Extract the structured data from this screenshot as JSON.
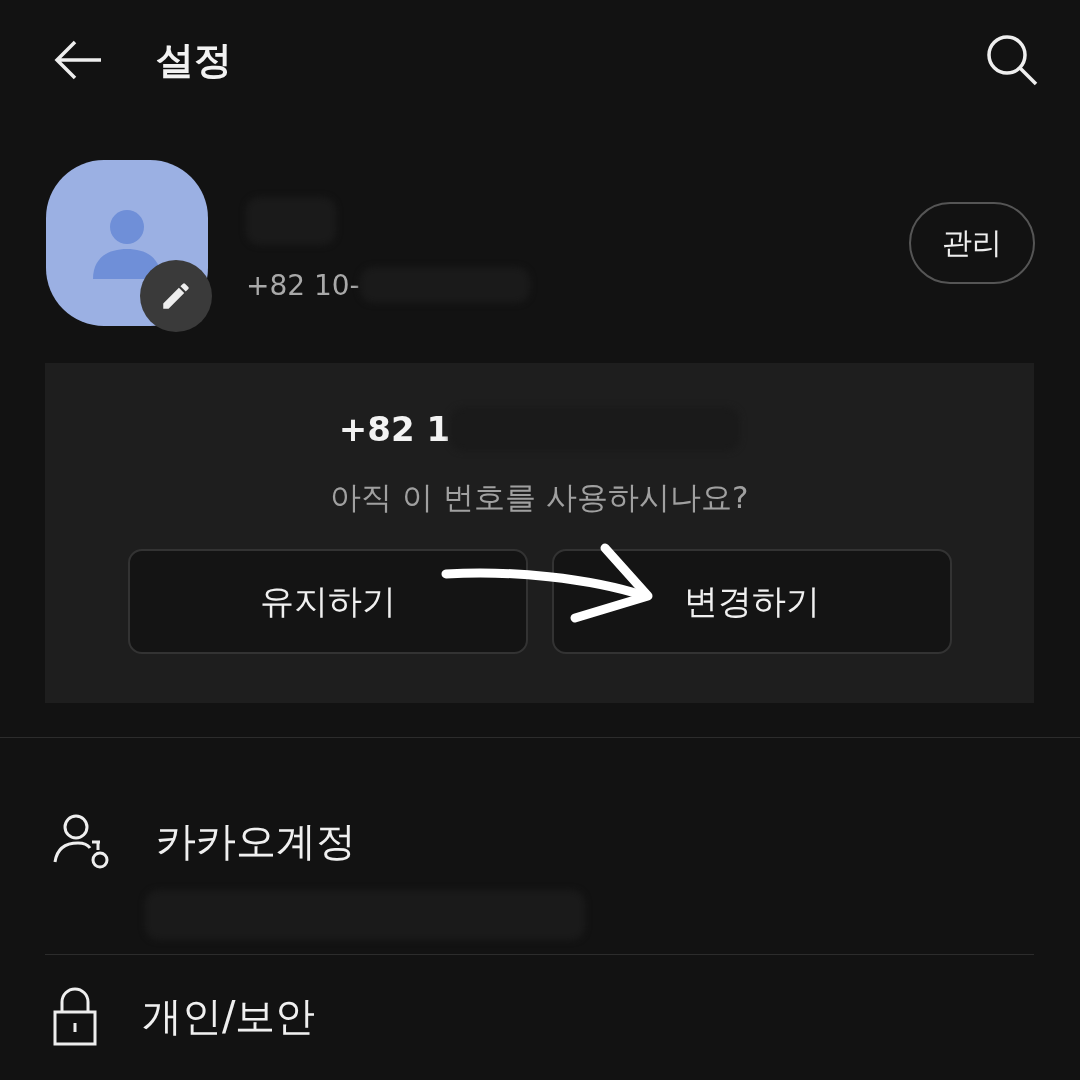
{
  "header": {
    "title": "설정"
  },
  "profile": {
    "phone": "+82 10-",
    "manage_button": "관리"
  },
  "card": {
    "number": "+82 1",
    "question": "아직 이 번호를 사용하시나요?",
    "buttons": [
      "유지하기",
      "변경하기"
    ]
  },
  "menu": [
    {
      "kind": "account",
      "label": "카카오계정"
    },
    {
      "kind": "lock",
      "label": "개인/보안"
    }
  ]
}
